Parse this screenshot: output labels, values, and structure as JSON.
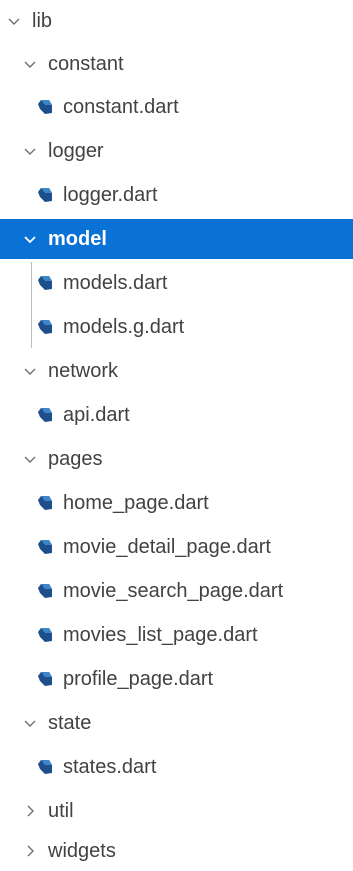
{
  "explorer": {
    "items": [
      {
        "label": "lib",
        "type": "folder",
        "expanded": true,
        "icon": "chevron-down-icon"
      },
      {
        "label": "constant",
        "type": "folder",
        "expanded": true,
        "icon": "chevron-down-icon"
      },
      {
        "label": "constant.dart",
        "type": "file",
        "icon": "dart-file-icon"
      },
      {
        "label": "logger",
        "type": "folder",
        "expanded": true,
        "icon": "chevron-down-icon"
      },
      {
        "label": "logger.dart",
        "type": "file",
        "icon": "dart-file-icon"
      },
      {
        "label": "model",
        "type": "folder",
        "expanded": true,
        "selected": true,
        "icon": "chevron-down-icon"
      },
      {
        "label": "models.dart",
        "type": "file",
        "icon": "dart-file-icon"
      },
      {
        "label": "models.g.dart",
        "type": "file",
        "icon": "dart-file-icon"
      },
      {
        "label": "network",
        "type": "folder",
        "expanded": true,
        "icon": "chevron-down-icon"
      },
      {
        "label": "api.dart",
        "type": "file",
        "icon": "dart-file-icon"
      },
      {
        "label": "pages",
        "type": "folder",
        "expanded": true,
        "icon": "chevron-down-icon"
      },
      {
        "label": "home_page.dart",
        "type": "file",
        "icon": "dart-file-icon"
      },
      {
        "label": "movie_detail_page.dart",
        "type": "file",
        "icon": "dart-file-icon"
      },
      {
        "label": "movie_search_page.dart",
        "type": "file",
        "icon": "dart-file-icon"
      },
      {
        "label": "movies_list_page.dart",
        "type": "file",
        "icon": "dart-file-icon"
      },
      {
        "label": "profile_page.dart",
        "type": "file",
        "icon": "dart-file-icon"
      },
      {
        "label": "state",
        "type": "folder",
        "expanded": true,
        "icon": "chevron-down-icon"
      },
      {
        "label": "states.dart",
        "type": "file",
        "icon": "dart-file-icon"
      },
      {
        "label": "util",
        "type": "folder",
        "expanded": false,
        "icon": "chevron-right-icon"
      },
      {
        "label": "widgets",
        "type": "folder",
        "expanded": false,
        "icon": "chevron-right-icon"
      }
    ]
  },
  "colors": {
    "selection": "#0a72d4",
    "text": "#424242",
    "dart_icon": "#1f4e8c"
  }
}
